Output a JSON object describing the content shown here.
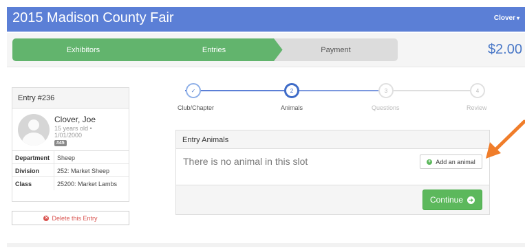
{
  "header": {
    "title": "2015 Madison County Fair",
    "user": "Clover",
    "user_caret": "▾"
  },
  "progress_steps": [
    {
      "label": "Exhibitors",
      "state": "complete"
    },
    {
      "label": "Entries",
      "state": "complete"
    },
    {
      "label": "Payment",
      "state": "pending"
    }
  ],
  "total": "$2.00",
  "entry": {
    "title": "Entry #236",
    "exhibitor_name": "Clover, Joe",
    "age": "15 years old •",
    "dob": "1/01/2000",
    "badge": "#45",
    "details": [
      {
        "label": "Department",
        "value": "Sheep"
      },
      {
        "label": "Division",
        "value": "252: Market Sheep"
      },
      {
        "label": "Class",
        "value": "25200: Market Lambs"
      }
    ],
    "delete_label": "Delete this Entry"
  },
  "wizard": {
    "steps": [
      {
        "number": "✓",
        "label": "Club/Chapter",
        "state": "done"
      },
      {
        "number": "2",
        "label": "Animals",
        "state": "active"
      },
      {
        "number": "3",
        "label": "Questions",
        "state": "todo"
      },
      {
        "number": "4",
        "label": "Review",
        "state": "todo"
      }
    ]
  },
  "animals_panel": {
    "title": "Entry Animals",
    "empty_message": "There is no animal in this slot",
    "add_label": "Add an animal",
    "continue_label": "Continue"
  },
  "colors": {
    "brand_blue": "#5b7fd6",
    "success_green": "#5cb85c",
    "danger_red": "#d9534f",
    "annotation_orange": "#f07d2a"
  }
}
